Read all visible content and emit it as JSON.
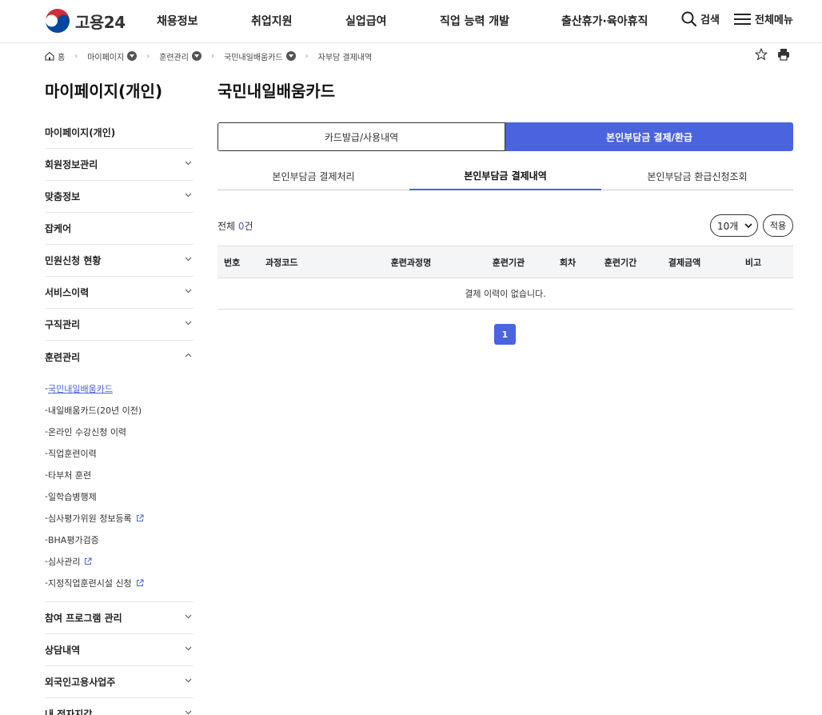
{
  "header": {
    "logo_text": "고용24",
    "nav": [
      "채용정보",
      "취업지원",
      "실업급여",
      "직업 능력 개발",
      "출산휴가·육아휴직"
    ],
    "search_label": "검색",
    "menu_label": "전체메뉴"
  },
  "breadcrumb": {
    "home": "홈",
    "items": [
      "마이페이지",
      "훈련관리",
      "국민내일배움카드",
      "자부담 결제내역"
    ]
  },
  "sidebar": {
    "title": "마이페이지(개인)",
    "items": [
      {
        "label": "마이페이지(개인)"
      },
      {
        "label": "회원정보관리"
      },
      {
        "label": "맞춤정보"
      },
      {
        "label": "잡케어"
      },
      {
        "label": "민원신청 현황"
      },
      {
        "label": "서비스이력"
      },
      {
        "label": "구직관리"
      },
      {
        "label": "훈련관리"
      }
    ],
    "sub_items": [
      {
        "label": "국민내일배움카드"
      },
      {
        "label": "내일배움카드(20년 이전)"
      },
      {
        "label": "온라인 수강신청 이력"
      },
      {
        "label": "직업훈련이력"
      },
      {
        "label": "타부처 훈련"
      },
      {
        "label": "일학습병행제"
      },
      {
        "label": "심사평가위원 정보등록"
      },
      {
        "label": "BHA평가검증"
      },
      {
        "label": "심사관리"
      },
      {
        "label": "지정직업훈련시설 신청"
      }
    ],
    "items_after": [
      {
        "label": "참여 프로그램 관리"
      },
      {
        "label": "상담내역"
      },
      {
        "label": "외국인고용사업주"
      },
      {
        "label": "내 전자지갑"
      }
    ]
  },
  "main": {
    "title": "국민내일배움카드",
    "segments": [
      "카드발급/사용내역",
      "본인부담금 결제/환급"
    ],
    "tabs": [
      "본인부담금 결제처리",
      "본인부담금 결제내역",
      "본인부담금 환급신청조회"
    ],
    "count_prefix": "전체 ",
    "count_num": "0",
    "count_suffix": "건",
    "per_page": "10개",
    "apply_label": "적용",
    "columns": [
      "번호",
      "과정코드",
      "훈련과정명",
      "훈련기관",
      "회차",
      "훈련기간",
      "결제금액",
      "비고"
    ],
    "empty_message": "결제 이력이 없습니다.",
    "page": "1"
  },
  "colors": {
    "accent": "#4a63de",
    "link": "#4a63de"
  }
}
